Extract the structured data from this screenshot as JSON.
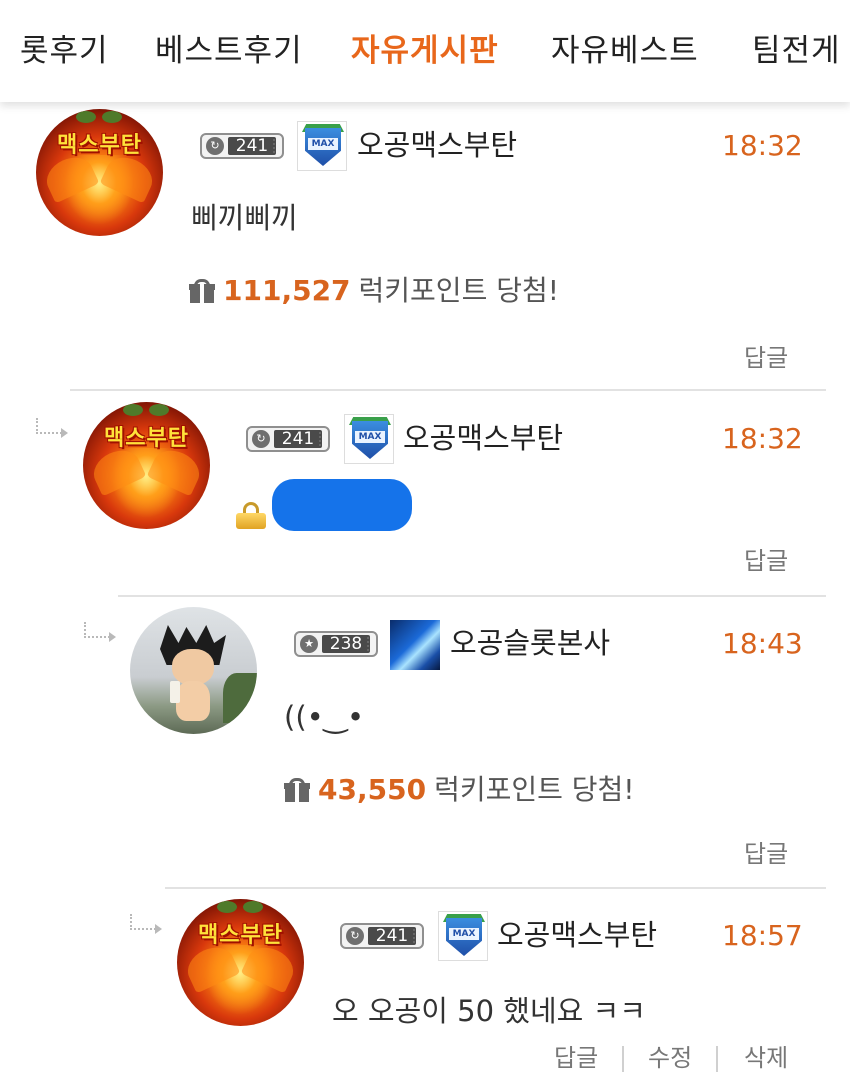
{
  "tabs": [
    {
      "label": "롯후기",
      "active": false
    },
    {
      "label": "베스트후기",
      "active": false
    },
    {
      "label": "자유게시판",
      "active": true
    },
    {
      "label": "자유베스트",
      "active": false
    },
    {
      "label": "팀전게",
      "active": false
    }
  ],
  "accent_color": "#e8671b",
  "comments": [
    {
      "avatar_text": "맥스부탄",
      "level": "241",
      "nickname": "오공맥스부탄",
      "time": "18:32",
      "text": "삐끼삐끼",
      "lucky_amount": "111,527",
      "lucky_label": "럭키포인트 당첨!",
      "actions": [
        "답글"
      ]
    },
    {
      "avatar_text": "맥스부탄",
      "level": "241",
      "nickname": "오공맥스부탄",
      "time": "18:32",
      "text": "",
      "secret": true,
      "actions": [
        "답글"
      ]
    },
    {
      "avatar_text": "",
      "level": "238",
      "nickname": "오공슬롯본사",
      "time": "18:43",
      "text": "((•‿•",
      "lucky_amount": "43,550",
      "lucky_label": "럭키포인트 당첨!",
      "actions": [
        "답글"
      ]
    },
    {
      "avatar_text": "맥스부탄",
      "level": "241",
      "nickname": "오공맥스부탄",
      "time": "18:57",
      "text": "오 오공이 50  했네요 ㅋㅋ",
      "actions": [
        "답글",
        "수정",
        "삭제"
      ]
    }
  ],
  "icons": [
    "gift-icon",
    "lock-icon",
    "reply-arrow-icon",
    "level-badge-icon",
    "rank-badge-icon"
  ]
}
